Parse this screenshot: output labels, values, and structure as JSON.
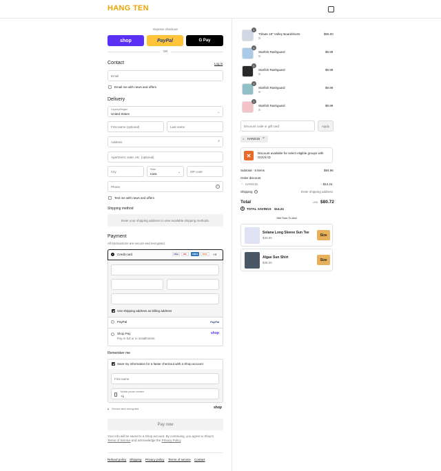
{
  "header": {
    "logo": "HANG TEN"
  },
  "express": {
    "title": "Express checkout",
    "shop_label": "shop",
    "paypal_label": "PayPal",
    "gpay_label": "G Pay",
    "or": "OR"
  },
  "contact": {
    "title": "Contact",
    "login": "Log in",
    "email_placeholder": "Email",
    "news_label": "Email me with news and offers"
  },
  "delivery": {
    "title": "Delivery",
    "country_label": "Country/Region",
    "country_value": "United States",
    "first_name": "First name (optional)",
    "last_name": "Last name",
    "address": "Address",
    "apartment": "Apartment, suite, etc. (optional)",
    "city": "City",
    "state_label": "State",
    "state_value": "Iowa",
    "zip": "ZIP code",
    "phone": "Phone",
    "text_label": "Text me with news and offers"
  },
  "shipping": {
    "title": "Shipping method",
    "notice": "Enter your shipping address to view available shipping methods."
  },
  "payment": {
    "title": "Payment",
    "subtitle": "All transactions are secure and encrypted.",
    "credit_card": "Credit card",
    "card_brands": [
      "VISA",
      "MC",
      "AMEX",
      "DISC"
    ],
    "more_cards": "+4",
    "billing_label": "Use shipping address as billing address",
    "paypal": "PayPal",
    "paypal_logo": "PayPal",
    "shop_pay": "Shop Pay",
    "shop_pay_sub": "Pay in full or in installments",
    "shop_logo": "shop"
  },
  "remember": {
    "title": "Remember me",
    "save_label": "Save my information for a faster checkout with a Shop account",
    "first_name": "First name",
    "mobile_label": "Mobile phone number",
    "mobile_value": "+1",
    "secure": "Secure and encrypted",
    "shop_logo": "shop"
  },
  "pay_now": "Pay now",
  "legal": {
    "line1": "Your info will be saved to a Shop account. By continuing, you agree to Shop's",
    "terms": "Terms of Service",
    "and_ack": "and acknowledge the",
    "privacy": "Privacy Policy",
    "period": "."
  },
  "footer": [
    "Refund policy",
    "Shipping",
    "Privacy policy",
    "Terms of service",
    "Contact"
  ],
  "cart": {
    "items": [
      {
        "qty": "1",
        "name": "Tribute 18\" Volley Boardshorts",
        "variant": "S",
        "price": "$55.00"
      },
      {
        "qty": "1",
        "name": "Starfish Rashguard",
        "variant": "S",
        "price": "$9.99"
      },
      {
        "qty": "1",
        "name": "Starfish Rashguard",
        "variant": "S",
        "price": "$9.99"
      },
      {
        "qty": "1",
        "name": "Starfish Rashguard",
        "variant": "S",
        "price": "$9.99"
      },
      {
        "qty": "1",
        "name": "Starfish Rashguard",
        "variant": "S",
        "price": "$9.99"
      }
    ],
    "discount_placeholder": "Discount code or gift card",
    "apply": "Apply",
    "code_tag": "HANG15",
    "govx_text": "Discount available for select eligible groups with GOVX ID",
    "subtotal_label": "Subtotal · 5 items",
    "subtotal_value": "$94.96",
    "order_discount_label": "Order discount",
    "discount_code": "HANG15",
    "discount_value": "- $14.24",
    "shipping_label": "Shipping",
    "shipping_value": "Enter shipping address",
    "total_label": "Total",
    "currency": "USD",
    "total_value": "$80.72",
    "savings_label": "TOTAL SAVINGS",
    "savings_value": "$14.24",
    "upsell_title": "Still Time To Add",
    "upsells": [
      {
        "name": "Solana Long Sleeve Sun Tee",
        "price": "$40.00",
        "button": "Size"
      },
      {
        "name": "Algae Sun Shirt",
        "price": "$36.00",
        "button": "Size"
      }
    ]
  },
  "colors": {
    "shop_purple": "#5a31f4",
    "paypal_yellow": "#ffc439",
    "logo_orange": "#e8a400",
    "size_button": "#e8b05a"
  }
}
